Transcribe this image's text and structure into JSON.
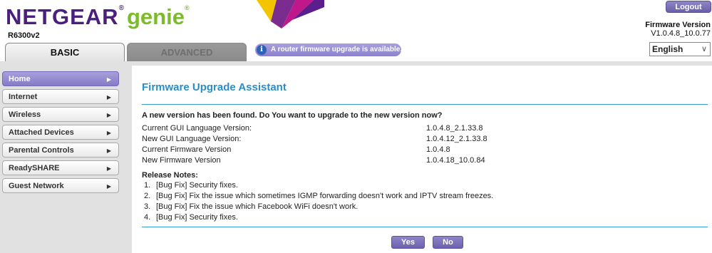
{
  "header": {
    "brand": "NETGEAR",
    "brand_reg": "®",
    "product": "genie",
    "product_tm": "®",
    "model": "R6300v2",
    "logout_label": "Logout",
    "firmware_title": "Firmware Version",
    "firmware_value": "V1.0.4.8_10.0.77"
  },
  "tabs": [
    {
      "label": "BASIC",
      "active": true
    },
    {
      "label": "ADVANCED",
      "active": false
    }
  ],
  "notice": {
    "icon": "info-icon",
    "text": "A router firmware upgrade is available."
  },
  "language": {
    "selected": "English"
  },
  "sidebar": {
    "items": [
      {
        "label": "Home",
        "active": true
      },
      {
        "label": "Internet",
        "active": false
      },
      {
        "label": "Wireless",
        "active": false
      },
      {
        "label": "Attached Devices",
        "active": false
      },
      {
        "label": "Parental Controls",
        "active": false
      },
      {
        "label": "ReadySHARE",
        "active": false
      },
      {
        "label": "Guest Network",
        "active": false
      }
    ]
  },
  "main": {
    "title": "Firmware Upgrade Assistant",
    "question": "A new version has been found. Do You want to upgrade to the new version now?",
    "rows": [
      {
        "label": "Current GUI Language Version:",
        "value": "1.0.4.8_2.1.33.8"
      },
      {
        "label": "New GUI Language Version:",
        "value": "1.0.4.12_2.1.33.8"
      },
      {
        "label": "Current Firmware Version",
        "value": "1.0.4.8"
      },
      {
        "label": "New Firmware Version",
        "value": "1.0.4.18_10.0.84"
      }
    ],
    "notes_title": "Release Notes:",
    "notes": [
      {
        "num": "1.",
        "text": "[Bug Fix] Security fixes."
      },
      {
        "num": "2.",
        "text": "[Bug Fix] Fix the issue which sometimes IGMP forwarding doesn't work and IPTV stream freezes."
      },
      {
        "num": "3.",
        "text": "[Bug Fix] Fix the issue which Facebook WiFi doesn't work."
      },
      {
        "num": "4.",
        "text": "[Bug Fix] Security fixes."
      }
    ],
    "yes_label": "Yes",
    "no_label": "No"
  },
  "colors": {
    "brand_purple": "#4a1f7e",
    "genie_green": "#7cbb2c",
    "accent_blue": "#2b8dc6",
    "button_purple": "#7a70bb"
  }
}
